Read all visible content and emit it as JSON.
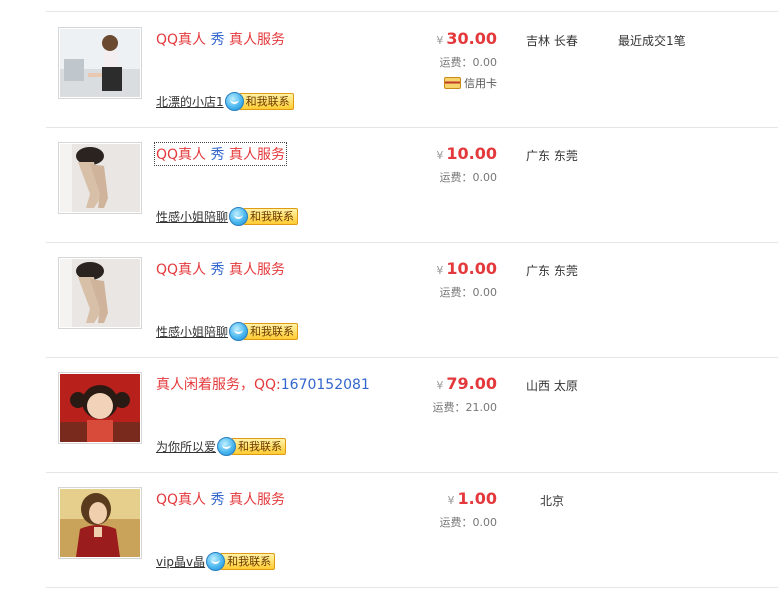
{
  "rows": [
    {
      "title": [
        {
          "text": "QQ真人 ",
          "color": "red"
        },
        {
          "text": "秀 ",
          "color": "blue"
        },
        {
          "text": "真人服务",
          "color": "red"
        }
      ],
      "seller": "北漂的小店1",
      "contact": "和我联系",
      "currency": "¥",
      "price": "30.00",
      "shipping": "运费：0.00",
      "payment": "信用卡",
      "location": "吉林 长春",
      "recent": "最近成交1笔"
    },
    {
      "title": [
        {
          "text": "QQ真人 ",
          "color": "red"
        },
        {
          "text": "秀 ",
          "color": "blue"
        },
        {
          "text": "真人服务",
          "color": "red"
        }
      ],
      "seller": "性感小姐陪聊",
      "contact": "和我联系",
      "currency": "¥",
      "price": "10.00",
      "shipping": "运费：0.00",
      "location": "广东 东莞"
    },
    {
      "title": [
        {
          "text": "QQ真人 ",
          "color": "red"
        },
        {
          "text": "秀 ",
          "color": "blue"
        },
        {
          "text": "真人服务",
          "color": "red"
        }
      ],
      "seller": "性感小姐陪聊",
      "contact": "和我联系",
      "currency": "¥",
      "price": "10.00",
      "shipping": "运费：0.00",
      "location": "广东 东莞"
    },
    {
      "title": [
        {
          "text": "真人闲着服务，",
          "color": "red"
        },
        {
          "text": "QQ:",
          "color": "red"
        },
        {
          "text": "1670152081",
          "color": "blue"
        }
      ],
      "seller": "为你所以爱",
      "contact": "和我联系",
      "currency": "¥",
      "price": "79.00",
      "shipping": "运费：21.00",
      "location": "山西 太原"
    },
    {
      "title": [
        {
          "text": "QQ真人 ",
          "color": "red"
        },
        {
          "text": "秀 ",
          "color": "blue"
        },
        {
          "text": "真人服务",
          "color": "red"
        }
      ],
      "seller": "vip晶v晶",
      "contact": "和我联系",
      "currency": "¥",
      "price": "1.00",
      "shipping": "运费：0.00",
      "location": "北京"
    }
  ],
  "colors": {
    "price_red": "#e4393c",
    "link_blue": "#3366cc",
    "divider": "#e6e6e6"
  }
}
